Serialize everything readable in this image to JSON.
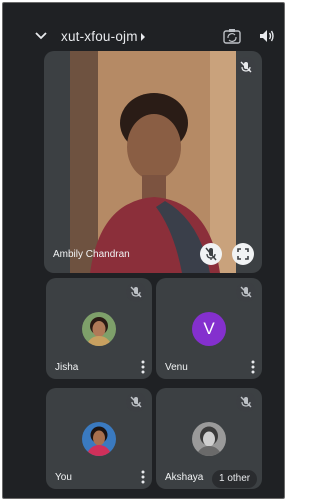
{
  "header": {
    "meeting_code": "xut-xfou-ojm"
  },
  "main_participant": {
    "name": "Ambily Chandran",
    "muted": true
  },
  "participants": [
    {
      "name": "Jisha",
      "avatar": "photo",
      "muted": true
    },
    {
      "name": "Venu",
      "avatar_letter": "V",
      "avatar_color": "#8430ce",
      "muted": true
    },
    {
      "name": "You",
      "avatar": "photo",
      "muted": true
    },
    {
      "name": "Akshaya",
      "avatar": "photo",
      "muted": true,
      "badge": "1 other"
    }
  ],
  "icons": {
    "back": "chevron-down-icon",
    "code_expand": "caret-right-icon",
    "camera_switch": "camera-flip-icon",
    "audio": "volume-icon",
    "mute": "mic-off-icon",
    "fullscreen": "fullscreen-icon",
    "more": "more-vert-icon"
  },
  "colors": {
    "background": "#1f2124",
    "tile": "#3c4043",
    "text": "#e8eaed",
    "accent_avatar": "#8430ce"
  }
}
